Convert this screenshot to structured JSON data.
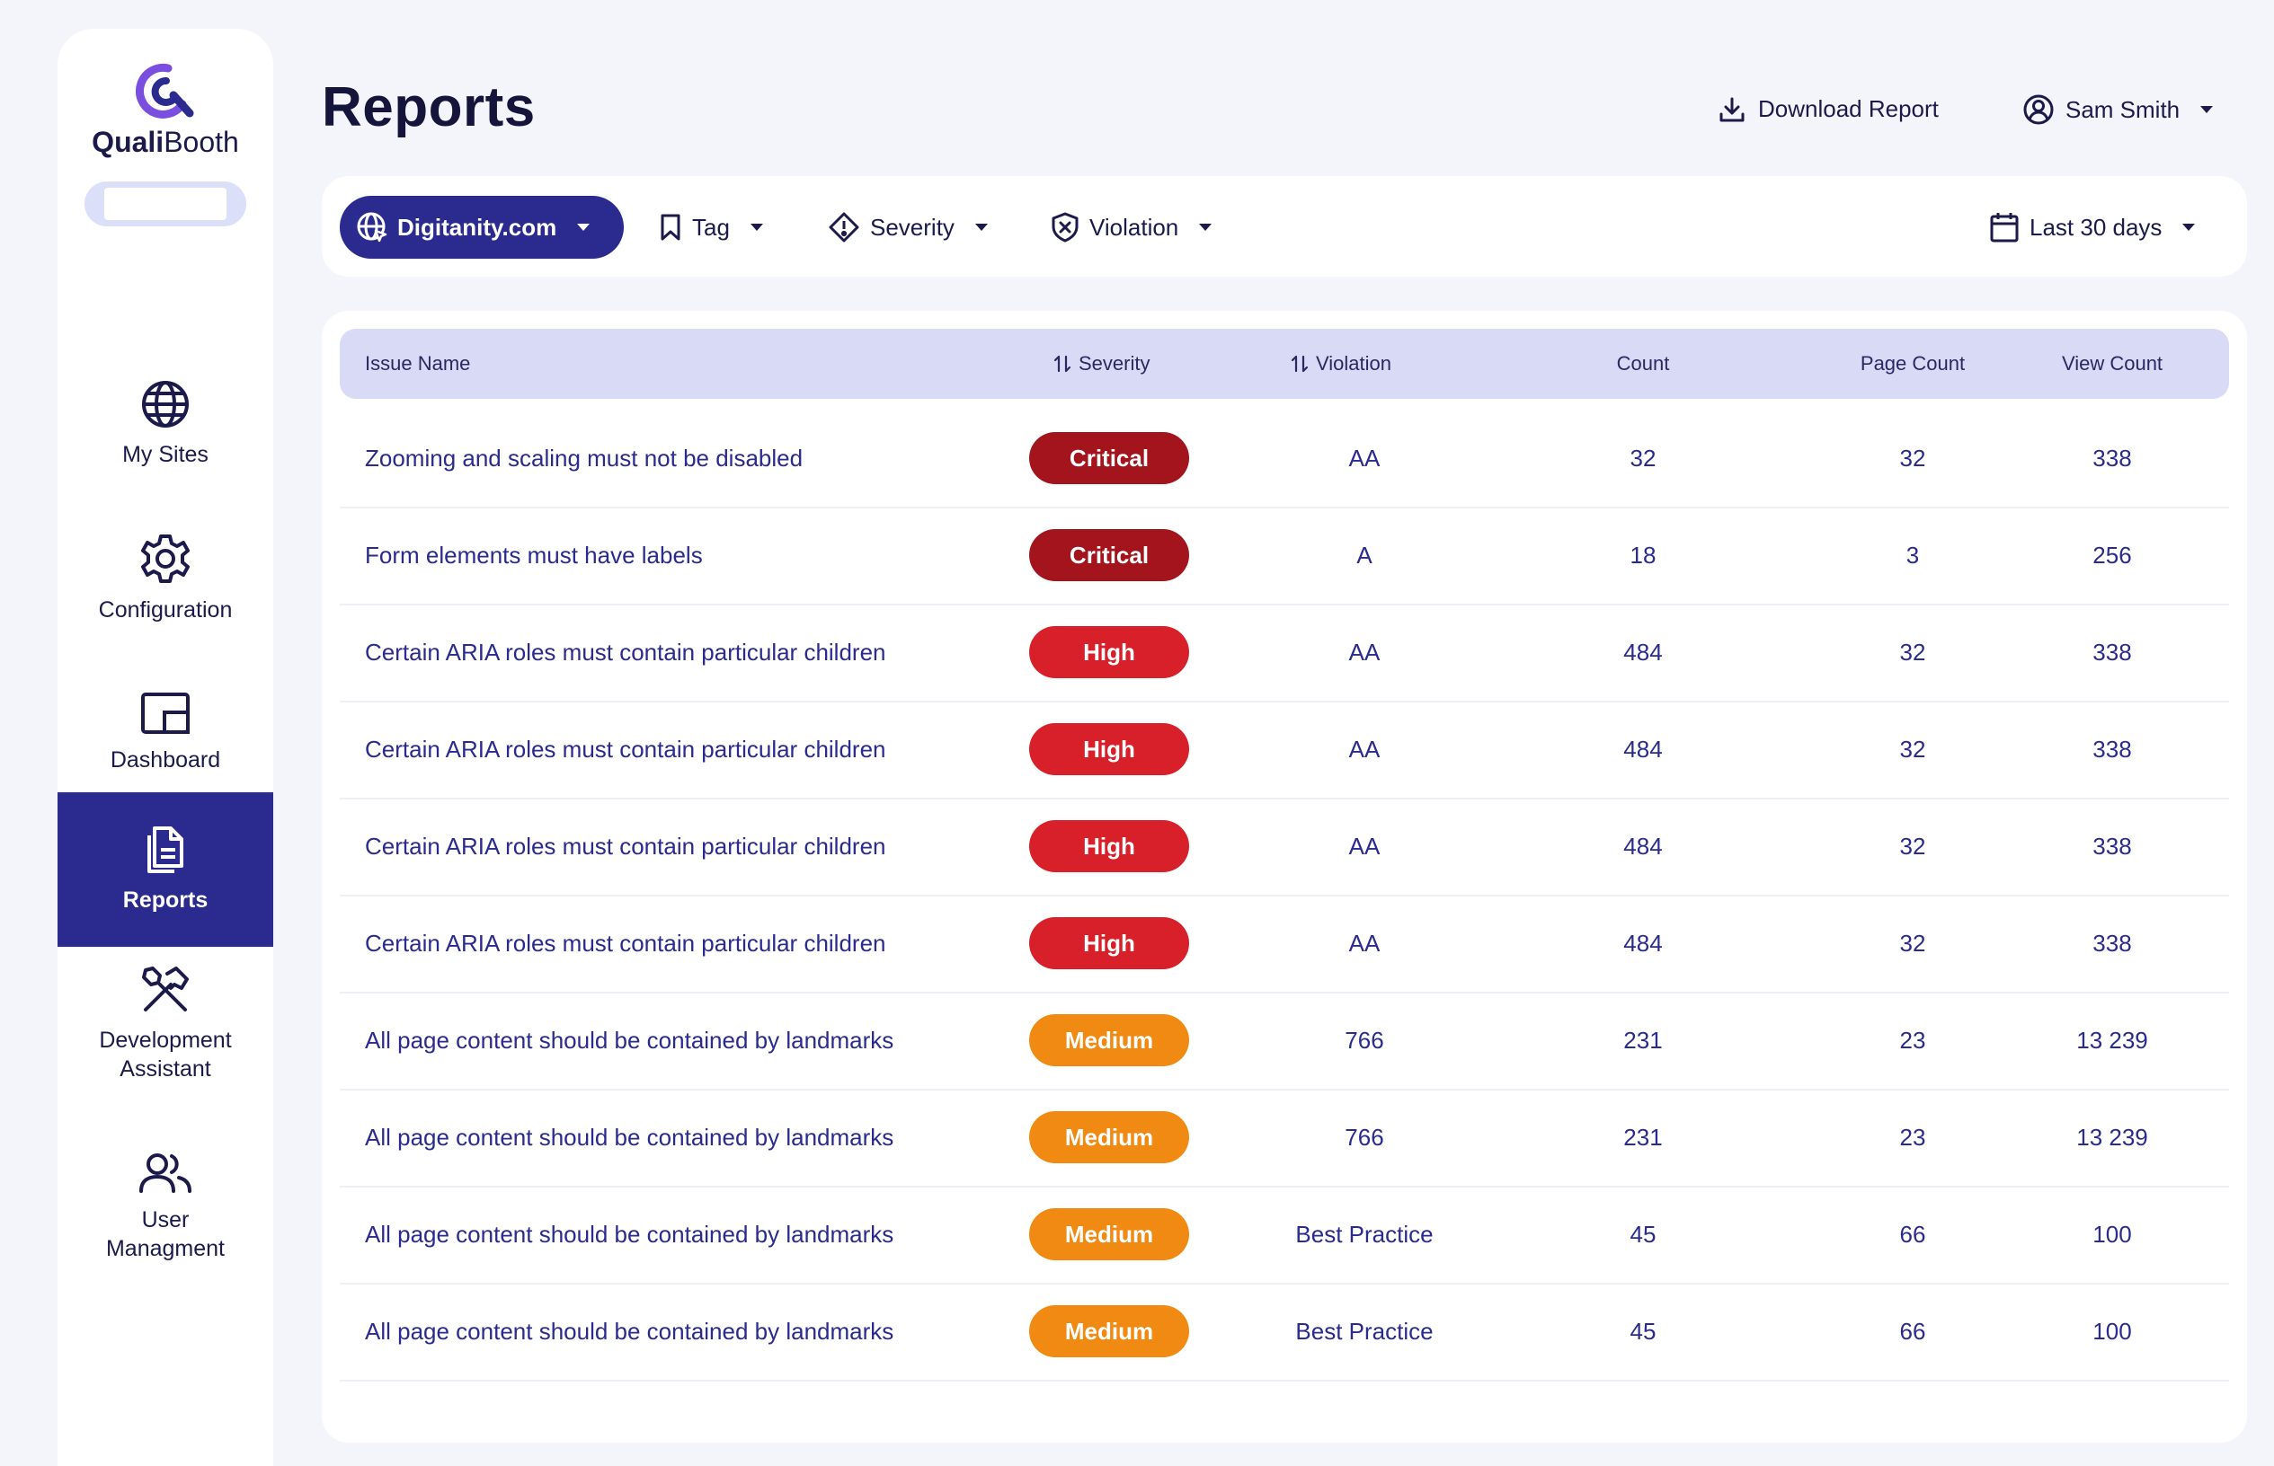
{
  "brand": {
    "name_bold": "Quali",
    "name_regular": "Booth"
  },
  "sidebar": {
    "items": [
      {
        "label": "My Sites",
        "icon": "globe-icon"
      },
      {
        "label": "Configuration",
        "icon": "gear-icon"
      },
      {
        "label": "Dashboard",
        "icon": "dashboard-icon"
      },
      {
        "label": "Reports",
        "icon": "document-icon",
        "active": true
      },
      {
        "label": "Development Assistant",
        "icon": "tools-icon"
      },
      {
        "label": "User Managment",
        "icon": "users-icon"
      }
    ]
  },
  "header": {
    "title": "Reports",
    "download_label": "Download Report",
    "user_name": "Sam Smith"
  },
  "filters": {
    "site": "Digitanity.com",
    "tag": "Tag",
    "severity": "Severity",
    "violation": "Violation",
    "date_range": "Last 30 days"
  },
  "table": {
    "columns": {
      "issue": "Issue Name",
      "severity": "Severity",
      "violation": "Violation",
      "count": "Count",
      "page_count": "Page Count",
      "view_count": "View Count"
    },
    "rows": [
      {
        "issue": "Zooming and scaling must not be disabled",
        "severity": "Critical",
        "violation": "AA",
        "count": "32",
        "page_count": "32",
        "view_count": "338"
      },
      {
        "issue": "Form elements must have labels",
        "severity": "Critical",
        "violation": "A",
        "count": "18",
        "page_count": "3",
        "view_count": "256"
      },
      {
        "issue": "Certain ARIA roles must contain particular children",
        "severity": "High",
        "violation": "AA",
        "count": "484",
        "page_count": "32",
        "view_count": "338"
      },
      {
        "issue": "Certain ARIA roles must contain particular children",
        "severity": "High",
        "violation": "AA",
        "count": "484",
        "page_count": "32",
        "view_count": "338"
      },
      {
        "issue": "Certain ARIA roles must contain particular children",
        "severity": "High",
        "violation": "AA",
        "count": "484",
        "page_count": "32",
        "view_count": "338"
      },
      {
        "issue": "Certain ARIA roles must contain particular children",
        "severity": "High",
        "violation": "AA",
        "count": "484",
        "page_count": "32",
        "view_count": "338"
      },
      {
        "issue": "All page content should be contained by landmarks",
        "severity": "Medium",
        "violation": "766",
        "count": "231",
        "page_count": "23",
        "view_count": "13 239"
      },
      {
        "issue": "All page content should be contained by landmarks",
        "severity": "Medium",
        "violation": "766",
        "count": "231",
        "page_count": "23",
        "view_count": "13 239"
      },
      {
        "issue": "All page content should be contained by landmarks",
        "severity": "Medium",
        "violation": "Best Practice",
        "count": "45",
        "page_count": "66",
        "view_count": "100"
      },
      {
        "issue": "All page content should be contained by landmarks",
        "severity": "Medium",
        "violation": "Best Practice",
        "count": "45",
        "page_count": "66",
        "view_count": "100"
      }
    ]
  },
  "colors": {
    "accent": "#2a2a8f",
    "critical": "#a3141c",
    "high": "#d8202a",
    "medium": "#f08a13",
    "table_header": "#d9daf6",
    "background": "#f3f5fb"
  }
}
